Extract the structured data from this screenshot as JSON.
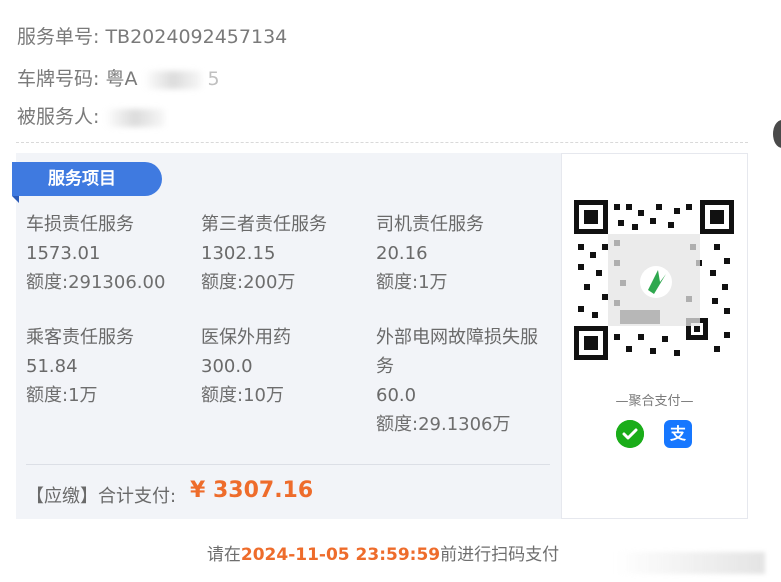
{
  "header": {
    "order_label": "服务单号:",
    "order_value": "TB2024092457134",
    "plate_label": "车牌号码:",
    "plate_value": "粤A",
    "plate_tail": "5",
    "insured_label": "被服务人:"
  },
  "section": {
    "title": "服务项目"
  },
  "services": [
    {
      "name": "车损责任服务",
      "amount": "1573.01",
      "quota": "额度:291306.00"
    },
    {
      "name": "第三者责任服务",
      "amount": "1302.15",
      "quota": "额度:200万"
    },
    {
      "name": "司机责任服务",
      "amount": "20.16",
      "quota": "额度:1万"
    },
    {
      "name": "乘客责任服务",
      "amount": "51.84",
      "quota": "额度:1万"
    },
    {
      "name": "医保外用药",
      "amount": "300.0",
      "quota": "额度:10万"
    },
    {
      "name": "外部电网故障损失服务",
      "amount": "60.0",
      "quota": "额度:29.1306万"
    }
  ],
  "total": {
    "label": "【应缴】合计支付:",
    "amount": "¥ 3307.16"
  },
  "payment": {
    "caption": "—聚合支付—",
    "wechat_icon": "wechat-pay-icon",
    "alipay_icon": "alipay-icon",
    "alipay_glyph": "支",
    "wechat_color": "#1aad19",
    "alipay_color": "#1677ff"
  },
  "deadline": {
    "prefix": "请在",
    "datetime": "2024-11-05 23:59:59",
    "suffix": "前进行扫码支付"
  }
}
